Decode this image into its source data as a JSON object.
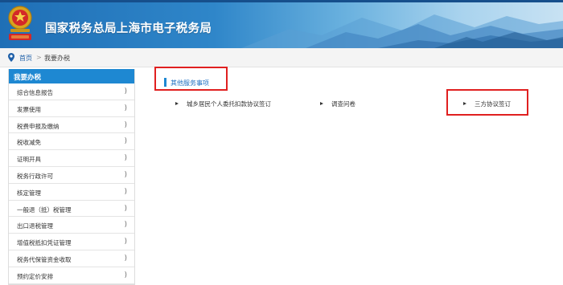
{
  "header": {
    "title": "国家税务总局上海市电子税务局",
    "emblem_icon": "tax-emblem-icon"
  },
  "breadcrumb": {
    "icon": "location-pin-icon",
    "home": "首页",
    "separator": ">",
    "current": "我要办税"
  },
  "sidebar": {
    "header": "我要办税",
    "items": [
      {
        "label": "综合信息报告",
        "arrow": ")"
      },
      {
        "label": "发票使用",
        "arrow": ")"
      },
      {
        "label": "税费申报及缴纳",
        "arrow": ")"
      },
      {
        "label": "税收减免",
        "arrow": ")"
      },
      {
        "label": "证明开具",
        "arrow": ")"
      },
      {
        "label": "税务行政许可",
        "arrow": ")"
      },
      {
        "label": "核定管理",
        "arrow": ")"
      },
      {
        "label": "一般退（抵）税管理",
        "arrow": ")"
      },
      {
        "label": "出口退税管理",
        "arrow": ")"
      },
      {
        "label": "增值税抵扣凭证管理",
        "arrow": ")"
      },
      {
        "label": "税务代保管资金收取",
        "arrow": ")"
      },
      {
        "label": "预约定价安排",
        "arrow": ")"
      }
    ]
  },
  "main": {
    "section_title": "其他服务事项",
    "services": [
      {
        "label": "城乡居民个人委托扣款协议签订"
      },
      {
        "label": "调查问卷"
      },
      {
        "label": "三方协议签订"
      }
    ]
  },
  "colors": {
    "accent": "#1e88d2",
    "highlight_border": "#e02020",
    "link": "#1e5fa8"
  }
}
